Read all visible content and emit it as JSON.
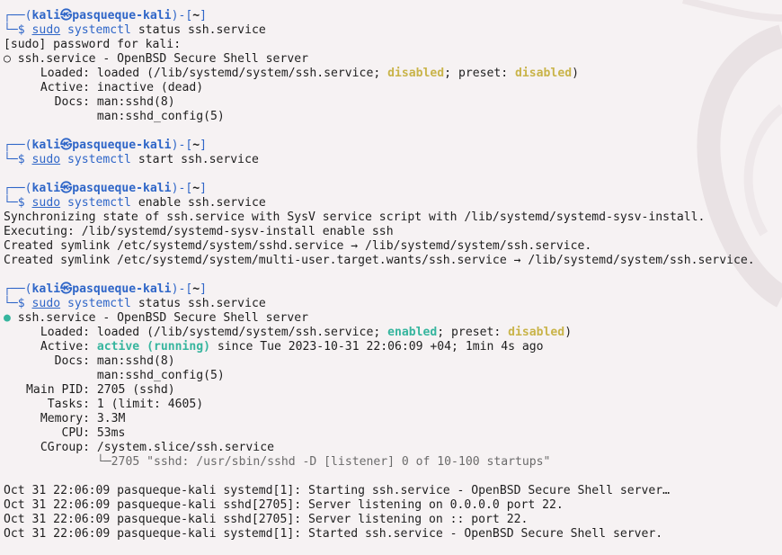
{
  "prompt": {
    "top_open": "┌──(",
    "user": "kali",
    "at_icon": "㉿",
    "host": "pasqueque-kali",
    "mid": ")-[",
    "cwd": "~",
    "close": "]",
    "bottom": "└─$ ",
    "sudo": "sudo",
    "systemctl": "systemctl"
  },
  "blocks": [
    {
      "cmd_args": " status ssh.service",
      "output": [
        "[sudo] password for kali:",
        "○ ssh.service - OpenBSD Secure Shell server"
      ],
      "status": {
        "loaded_key": "Loaded:",
        "loaded_pre": " loaded (/lib/systemd/system/ssh.service; ",
        "loaded_state": "disabled",
        "loaded_mid": "; preset: ",
        "loaded_preset": "disabled",
        "loaded_post": ")",
        "active_key": "Active:",
        "active_val": " inactive (dead)",
        "docs_key": "Docs:",
        "docs": [
          " man:sshd(8)",
          " man:sshd_config(5)"
        ]
      }
    },
    {
      "cmd_args": " start ssh.service"
    },
    {
      "cmd_args": " enable ssh.service",
      "output": [
        "Synchronizing state of ssh.service with SysV service script with /lib/systemd/systemd-sysv-install.",
        "Executing: /lib/systemd/systemd-sysv-install enable ssh",
        "Created symlink /etc/systemd/system/sshd.service → /lib/systemd/system/ssh.service.",
        "Created symlink /etc/systemd/system/multi-user.target.wants/ssh.service → /lib/systemd/system/ssh.service."
      ]
    },
    {
      "cmd_args": " status ssh.service",
      "header_dot": "●",
      "header_text": " ssh.service - OpenBSD Secure Shell server",
      "status": {
        "loaded_key": "Loaded:",
        "loaded_pre": " loaded (/lib/systemd/system/ssh.service; ",
        "loaded_state": "enabled",
        "loaded_mid": "; preset: ",
        "loaded_preset": "disabled",
        "loaded_post": ")",
        "active_key": "Active:",
        "active_state": "active (running)",
        "active_rest": " since Tue 2023-10-31 22:06:09 +04; 1min 4s ago",
        "docs_key": "Docs:",
        "docs": [
          " man:sshd(8)",
          " man:sshd_config(5)"
        ],
        "pid_key": "Main PID:",
        "pid_val": " 2705 (sshd)",
        "tasks_key": "Tasks:",
        "tasks_val": " 1 (limit: 4605)",
        "mem_key": "Memory:",
        "mem_val": " 3.3M",
        "cpu_key": "CPU:",
        "cpu_val": " 53ms",
        "cgroup_key": "CGroup:",
        "cgroup_val": " /system.slice/ssh.service",
        "cgroup_tree": "└─",
        "cgroup_proc": "2705 \"sshd: /usr/sbin/sshd -D [listener] 0 of 10-100 startups\""
      },
      "log": [
        "Oct 31 22:06:09 pasqueque-kali systemd[1]: Starting ssh.service - OpenBSD Secure Shell server…",
        "Oct 31 22:06:09 pasqueque-kali sshd[2705]: Server listening on 0.0.0.0 port 22.",
        "Oct 31 22:06:09 pasqueque-kali sshd[2705]: Server listening on :: port 22.",
        "Oct 31 22:06:09 pasqueque-kali systemd[1]: Started ssh.service - OpenBSD Secure Shell server."
      ]
    }
  ]
}
